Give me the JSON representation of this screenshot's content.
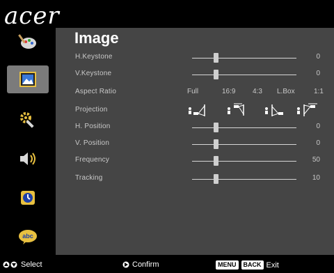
{
  "brand": "acer",
  "panel": {
    "title": "Image"
  },
  "sidebar": [
    {
      "name": "sidebar-item-color",
      "icon": "palette-icon",
      "active": false
    },
    {
      "name": "sidebar-item-image",
      "icon": "picture-icon",
      "active": true
    },
    {
      "name": "sidebar-item-settings",
      "icon": "gear-wrench-icon",
      "active": false
    },
    {
      "name": "sidebar-item-audio",
      "icon": "speaker-icon",
      "active": false
    },
    {
      "name": "sidebar-item-timer",
      "icon": "clock-icon",
      "active": false
    },
    {
      "name": "sidebar-item-language",
      "icon": "language-icon",
      "active": false
    }
  ],
  "rows": {
    "h_keystone": {
      "label": "H.Keystone",
      "value": "0"
    },
    "v_keystone": {
      "label": "V.Keystone",
      "value": "0"
    },
    "aspect_ratio": {
      "label": "Aspect Ratio",
      "options": [
        "Full",
        "16:9",
        "4:3",
        "L.Box",
        "1:1"
      ]
    },
    "projection": {
      "label": "Projection",
      "options": [
        "front-desktop-icon",
        "front-ceiling-icon",
        "rear-desktop-icon",
        "rear-ceiling-icon"
      ]
    },
    "h_position": {
      "label": "H. Position",
      "value": "0"
    },
    "v_position": {
      "label": "V. Position",
      "value": "0"
    },
    "frequency": {
      "label": "Frequency",
      "value": "50"
    },
    "tracking": {
      "label": "Tracking",
      "value": "10"
    }
  },
  "footer": {
    "select": "Select",
    "confirm": "Confirm",
    "menu_key": "MENU",
    "back_key": "BACK",
    "exit": "Exit"
  },
  "colors": {
    "panel": "#454545",
    "sidebar": "#000000",
    "active_bg": "#7b7b7b",
    "text": "#c9c9c9"
  }
}
